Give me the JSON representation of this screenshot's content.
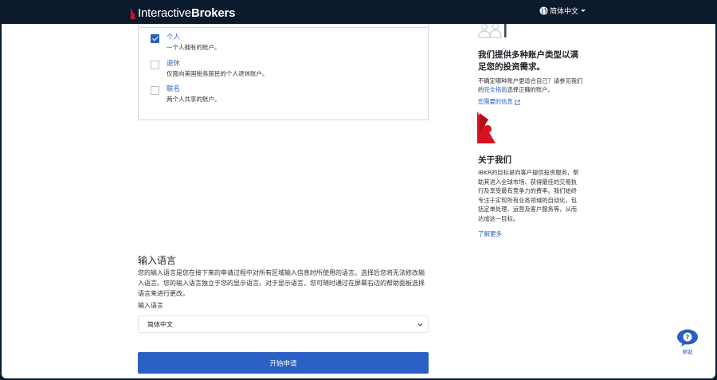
{
  "header": {
    "logo_light": "Interactive",
    "logo_bold": "Brokers",
    "language_label": "简体中文"
  },
  "account_types": [
    {
      "title": "个人",
      "description": "一个人拥有的账户。",
      "checked": true
    },
    {
      "title": "退休",
      "description": "仅面向美国税务居民的个人退休账户。",
      "checked": false
    },
    {
      "title": "联名",
      "description": "两个人共享的账户。",
      "checked": false
    }
  ],
  "input_language": {
    "title": "输入语言",
    "description": "您的输入语言是您在接下来的申请过程中对所有区域输入信息时所使用的语言。选择后您将无法修改输入语言。您的输入语言独立于您的显示语言。对于显示语言，您可随时通过在屏幕右边的帮助面板选择语言来进行更改。",
    "field_label": "输入语言",
    "selected": "简体中文"
  },
  "start_button": "开始申请",
  "sidebar": {
    "heading": "我们提供多种账户类型以满足您的投资需求。",
    "text_before_link": "不确定哪种账户更适合自己？请参见我们的",
    "link_text": "完全指南",
    "text_after_link": "选择正确的账户。",
    "info_link": "您需要的信息",
    "about_heading": "关于我们",
    "about_body": "IBKR的目标是向客户提供投资服务，帮助其进入全球市场、获得最佳的交易执行及享受最有竞争力的费率。我们始终专注于实现所有业务领域的自动化，包括定单处理、运营及客户服务等，从而达成这一目标。",
    "learn_more": "了解更多"
  },
  "help": {
    "label": "帮助"
  },
  "colors": {
    "brand_red": "#d81222",
    "accent_blue": "#2a5fc3",
    "topbar": "#0c1a2e"
  }
}
